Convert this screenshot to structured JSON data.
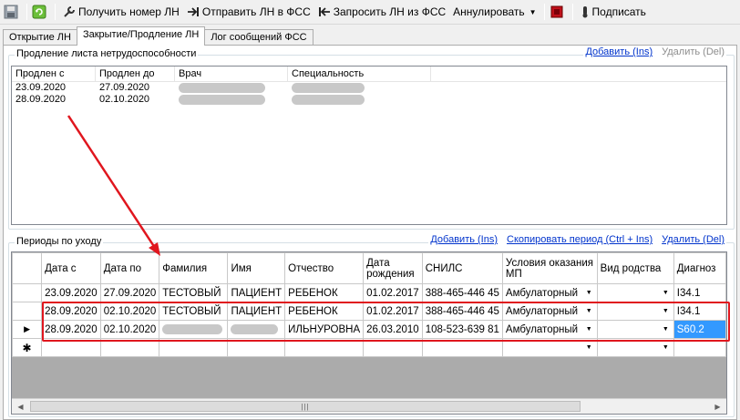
{
  "toolbar": {
    "get_number": "Получить номер ЛН",
    "send_fss": "Отправить ЛН в ФСС",
    "request_fss": "Запросить ЛН из ФСС",
    "cancel": "Аннулировать",
    "sign": "Подписать"
  },
  "tabs": [
    "Открытие ЛН",
    "Закрытие/Продление ЛН",
    "Лог сообщений ФСС"
  ],
  "extension": {
    "title": "Продление листа нетрудоспособности",
    "add": "Добавить (Ins)",
    "delete": "Удалить (Del)",
    "columns": [
      "Продлен с",
      "Продлен до",
      "Врач",
      "Специальность"
    ],
    "rows": [
      [
        "23.09.2020",
        "27.09.2020"
      ],
      [
        "28.09.2020",
        "02.10.2020"
      ]
    ]
  },
  "care": {
    "title": "Периоды по уходу",
    "add": "Добавить (Ins)",
    "copy": "Скопировать период (Ctrl + Ins)",
    "delete": "Удалить (Del)",
    "columns": [
      "Дата с",
      "Дата по",
      "Фамилия",
      "Имя",
      "Отчество",
      "Дата рождения",
      "СНИЛС",
      "Условия оказания МП",
      "Вид родства",
      "Диагноз"
    ],
    "rows": [
      {
        "from": "23.09.2020",
        "to": "27.09.2020",
        "last": "ТЕСТОВЫЙ",
        "first": "ПАЦИЕНТ",
        "middle": "РЕБЕНОК",
        "birth": "01.02.2017",
        "snils": "388-465-446 45",
        "cond": "Амбулаторный",
        "kin": "",
        "diag": "I34.1"
      },
      {
        "from": "28.09.2020",
        "to": "02.10.2020",
        "last": "ТЕСТОВЫЙ",
        "first": "ПАЦИЕНТ",
        "middle": "РЕБЕНОК",
        "birth": "01.02.2017",
        "snils": "388-465-446 45",
        "cond": "Амбулаторный",
        "kin": "",
        "diag": "I34.1"
      },
      {
        "from": "28.09.2020",
        "to": "02.10.2020",
        "last": "",
        "first": "",
        "middle": "ИЛЬНУРОВНА",
        "birth": "26.03.2010",
        "snils": "108-523-639 81",
        "cond": "Амбулаторный",
        "kin": "",
        "diag": "S60.2"
      }
    ]
  },
  "colors": {
    "accent_red": "#e0161e",
    "link": "#0033cc",
    "selection": "#3399ff"
  }
}
